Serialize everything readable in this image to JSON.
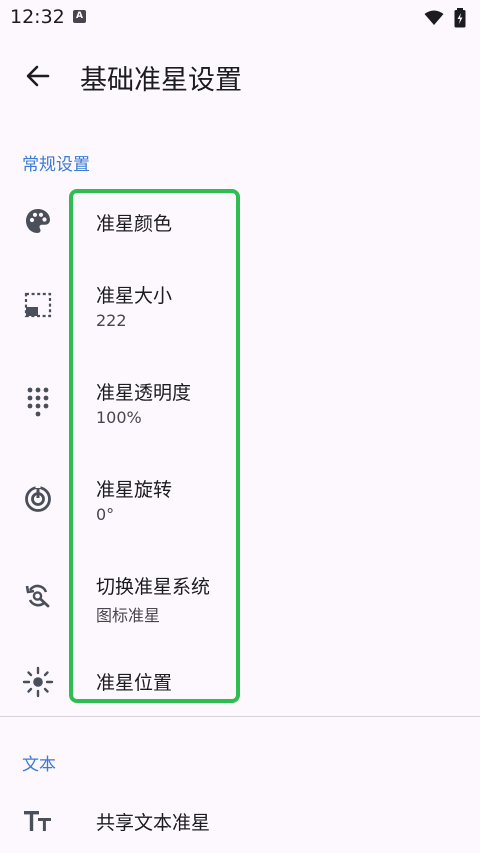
{
  "status": {
    "time": "12:32",
    "badge": "A"
  },
  "appbar": {
    "title": "基础准星设置"
  },
  "sections": {
    "general": "常规设置",
    "text": "文本"
  },
  "items": {
    "color": {
      "title": "准星颜色",
      "icon": "palette-icon"
    },
    "size": {
      "title": "准星大小",
      "value": "222",
      "icon": "aspect-ratio-icon"
    },
    "opacity": {
      "title": "准星透明度",
      "value": "100%",
      "icon": "dot-grid-icon"
    },
    "rotation": {
      "title": "准星旋转",
      "value": "0°",
      "icon": "target-rotate-icon"
    },
    "system": {
      "title": "切换准星系统",
      "value": "图标准星",
      "icon": "switch-refresh-icon"
    },
    "position": {
      "title": "准星位置",
      "icon": "crosshair-sun-icon"
    },
    "shared_text": {
      "title": "共享文本准星",
      "icon": "text-size-icon"
    }
  },
  "colors": {
    "accent": "#3b7bd5",
    "highlight": "#2ebd4f",
    "background": "#fdf8fd"
  }
}
